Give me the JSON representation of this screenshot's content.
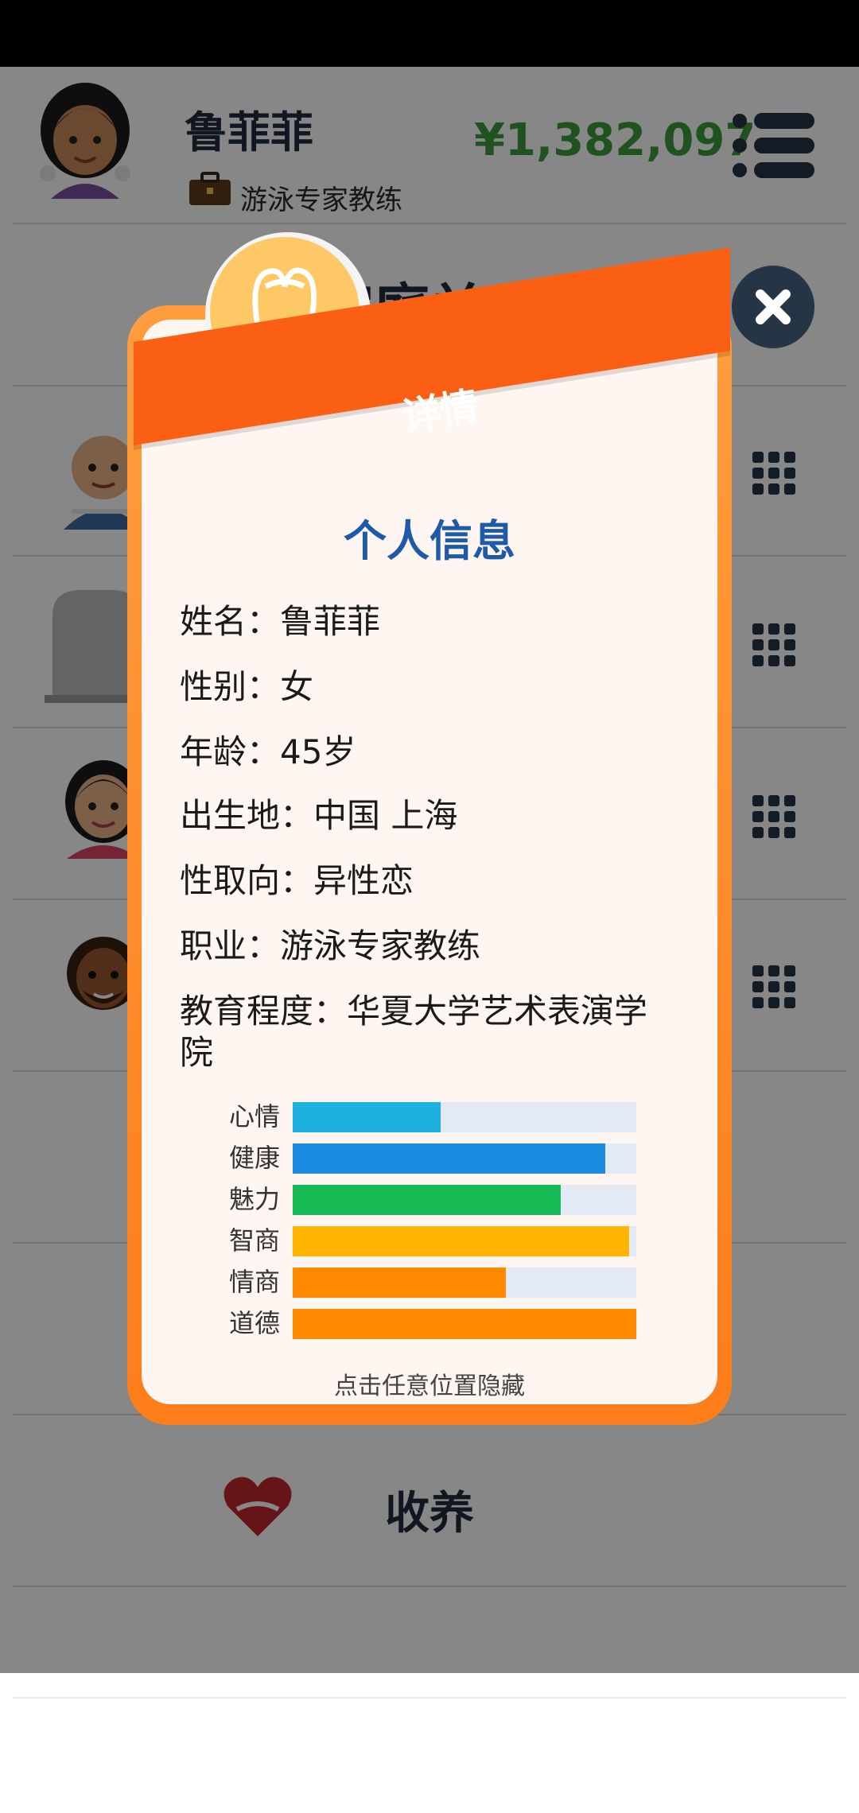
{
  "user": {
    "name": "鲁菲菲",
    "job": "游泳专家教练",
    "money": "¥1,382,097"
  },
  "page": {
    "section_title": "家庭关系",
    "adopt_label": "收养"
  },
  "dialog": {
    "banner": "详情",
    "title": "个人信息",
    "info": [
      {
        "label": "姓名：",
        "value": "鲁菲菲"
      },
      {
        "label": "性别：",
        "value": "女"
      },
      {
        "label": "年龄：",
        "value": "45岁"
      },
      {
        "label": "出生地：",
        "value": "中国 上海"
      },
      {
        "label": "性取向：",
        "value": "异性恋"
      },
      {
        "label": "职业：",
        "value": "游泳专家教练"
      },
      {
        "label": "教育程度：",
        "value": "华夏大学艺术表演学院"
      }
    ],
    "stats": [
      {
        "label": "心情",
        "value": 0.43,
        "color": "#1db1e0"
      },
      {
        "label": "健康",
        "value": 0.91,
        "color": "#1a8be0"
      },
      {
        "label": "魅力",
        "value": 0.78,
        "color": "#16bb55"
      },
      {
        "label": "智商",
        "value": 0.98,
        "color": "#ffb400"
      },
      {
        "label": "情商",
        "value": 0.62,
        "color": "#ff8a00"
      },
      {
        "label": "道德",
        "value": 1.0,
        "color": "#ff8a00"
      }
    ],
    "hint": "点击任意位置隐藏"
  },
  "icons": {
    "menu": "menu-icon",
    "close": "close-icon",
    "job": "briefcase-icon",
    "bulb": "light-bulb-icon",
    "row_menu": "grid-menu-icon",
    "adopt": "heart-hands-icon"
  }
}
